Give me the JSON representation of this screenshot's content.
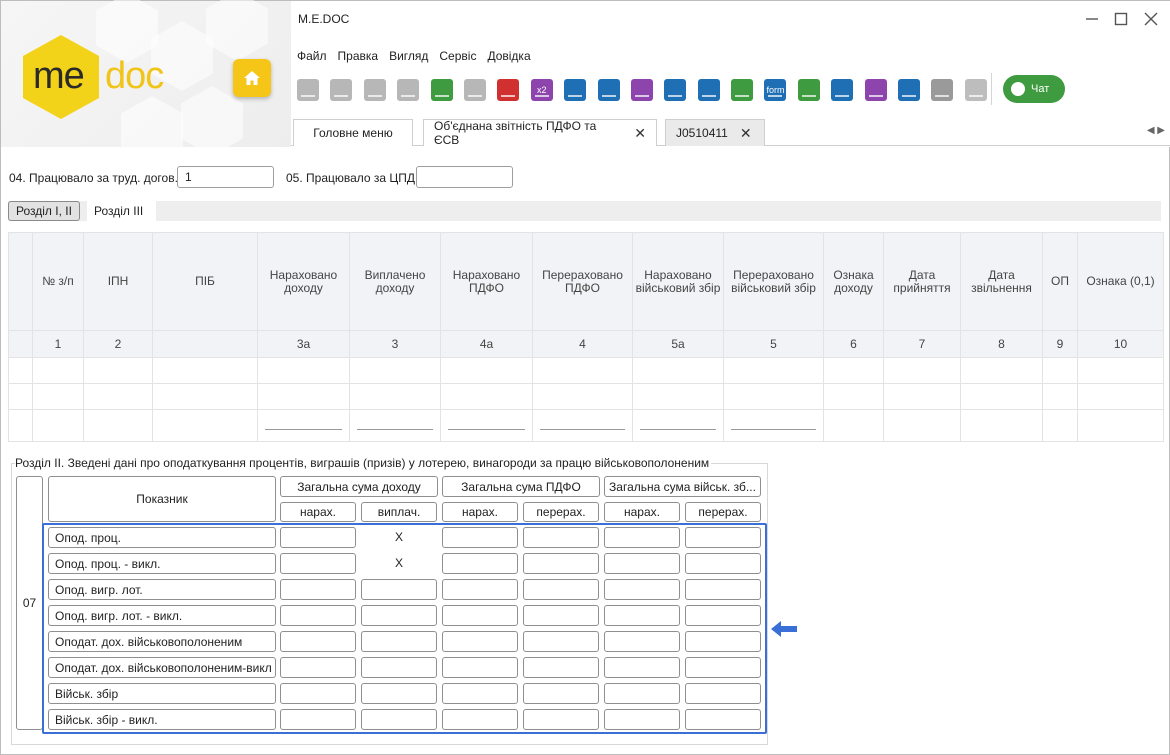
{
  "window": {
    "title": "M.E.DOC"
  },
  "logo": {
    "left": "me",
    "right": "doc"
  },
  "menu": [
    "Файл",
    "Правка",
    "Вигляд",
    "Сервіс",
    "Довідка"
  ],
  "toolbar": {
    "buttons": [
      {
        "icon": "new-doc-icon",
        "color": "#b7b7b7"
      },
      {
        "icon": "view-doc-icon",
        "color": "#b7b7b7"
      },
      {
        "icon": "copy-doc-icon",
        "color": "#b7b7b7"
      },
      {
        "icon": "transfer-doc-icon",
        "color": "#b7b7b7"
      },
      {
        "icon": "add-table-icon",
        "color": "#3f9b3f"
      },
      {
        "icon": "edit-table-icon",
        "color": "#b7b7b7"
      },
      {
        "icon": "delete-table-icon",
        "color": "#d03030"
      },
      {
        "icon": "x2-icon",
        "color": "#8e44ad"
      },
      {
        "icon": "save-icon",
        "color": "#1f6fb5"
      },
      {
        "icon": "preview-icon",
        "color": "#1f6fb5"
      },
      {
        "icon": "print-icon",
        "color": "#8e44ad"
      },
      {
        "icon": "send-icon",
        "color": "#1f6fb5"
      },
      {
        "icon": "refresh-mail-icon",
        "color": "#1f6fb5"
      },
      {
        "icon": "search-doc-icon",
        "color": "#3f9b3f"
      },
      {
        "icon": "form-icon",
        "color": "#1f6fb5"
      },
      {
        "icon": "check-list-icon",
        "color": "#3f9b3f"
      },
      {
        "icon": "recalc-icon",
        "color": "#1f6fb5"
      },
      {
        "icon": "grid-icon",
        "color": "#8e44ad"
      },
      {
        "icon": "export-icon",
        "color": "#1f6fb5"
      },
      {
        "icon": "filter-icon",
        "color": "#9a9a9a"
      },
      {
        "icon": "verify-icon",
        "color": "#bdbdbd"
      }
    ],
    "chat_label": "Чат",
    "tb_x2": "x2",
    "tb_form": "form"
  },
  "tabs": [
    {
      "label": "Головне меню",
      "closable": false
    },
    {
      "label": "Об'єднана звітність ПДФО та ЄСВ",
      "closable": true
    },
    {
      "label": "J0510411",
      "closable": true
    }
  ],
  "form": {
    "field04_label": "04. Працювало за труд. догов.",
    "field04_value": "1",
    "field05_label": "05. Працювало за ЦПД",
    "field05_value": ""
  },
  "section_tabs": [
    "Розділ І, ІІ",
    "Розділ ІІІ"
  ],
  "main_table": {
    "headers": [
      "№ з/п",
      "ІПН",
      "ПІБ",
      "Нараховано доходу",
      "Виплачено доходу",
      "Нараховано ПДФО",
      "Перераховано ПДФО",
      "Нараховано військовий збір",
      "Перераховано військовий збір",
      "Ознака доходу",
      "Дата прийняття",
      "Дата звільнення",
      "ОП",
      "Ознака (0,1)"
    ],
    "numbers": [
      "1",
      "2",
      "",
      "3а",
      "3",
      "4а",
      "4",
      "5а",
      "5",
      "6",
      "7",
      "8",
      "9",
      "10"
    ]
  },
  "section2": {
    "title": "Розділ ІІ. Зведені дані про оподаткування процентів, виграшів (призів) у лотерею, винагороди за працю військовополоненим",
    "row_code": "07",
    "indicator_header": "Показник",
    "group_headers": [
      "Загальна сума доходу",
      "Загальна сума ПДФО",
      "Загальна сума військ. зб..."
    ],
    "sub_headers": [
      "нарах.",
      "виплач.",
      "нарах.",
      "перерах.",
      "нарах.",
      "перерах."
    ],
    "rows": [
      {
        "label": "Опод. проц.",
        "paid_x": "X"
      },
      {
        "label": "Опод. проц. - викл.",
        "paid_x": "X"
      },
      {
        "label": "Опод. вигр. лот.",
        "paid_x": ""
      },
      {
        "label": "Опод. вигр. лот. - викл.",
        "paid_x": ""
      },
      {
        "label": "Оподат. дох. військовополоненим",
        "paid_x": ""
      },
      {
        "label": "Оподат. дох. військовополоненим-викл",
        "paid_x": ""
      },
      {
        "label": "Військ. збір",
        "paid_x": ""
      },
      {
        "label": "Військ. збір - викл.",
        "paid_x": ""
      }
    ]
  },
  "colors": {
    "accent": "#3a6fd8",
    "logo_yellow": "#f3d21a",
    "chat_green": "#3f9b3f"
  }
}
